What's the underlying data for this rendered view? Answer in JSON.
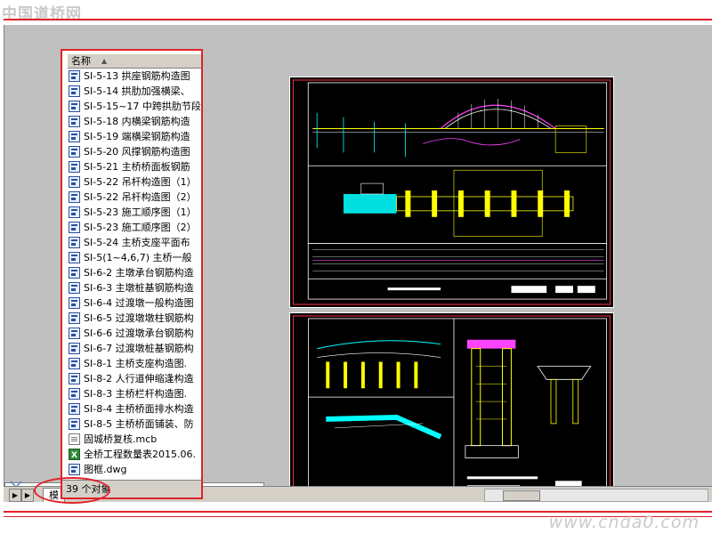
{
  "header": {
    "site_logo": "中国道桥网"
  },
  "file_panel": {
    "column_header": "名称",
    "items": [
      {
        "name": "SI-5-13 拱座钢筋构造图",
        "icon": "cad-drawing-icon"
      },
      {
        "name": "SI-5-14 拱肋加强横梁、",
        "icon": "cad-drawing-icon"
      },
      {
        "name": "SI-5-15~17 中跨拱肋节段",
        "icon": "cad-drawing-icon"
      },
      {
        "name": "SI-5-18 内横梁钢筋构造",
        "icon": "cad-drawing-icon"
      },
      {
        "name": "SI-5-19 端横梁钢筋构造",
        "icon": "cad-drawing-icon"
      },
      {
        "name": "SI-5-20 风撑钢筋构造图",
        "icon": "cad-drawing-icon"
      },
      {
        "name": "SI-5-21 主桥桥面板钢筋",
        "icon": "cad-drawing-icon"
      },
      {
        "name": "SI-5-22 吊杆构造图（1）",
        "icon": "cad-drawing-icon"
      },
      {
        "name": "SI-5-22 吊杆构造图（2）",
        "icon": "cad-drawing-icon"
      },
      {
        "name": "SI-5-23 施工顺序图（1）",
        "icon": "cad-drawing-icon"
      },
      {
        "name": "SI-5-23 施工顺序图（2）",
        "icon": "cad-drawing-icon"
      },
      {
        "name": "SI-5-24 主桥支座平面布",
        "icon": "cad-drawing-icon"
      },
      {
        "name": "SI-5(1~4,6,7) 主桥一般",
        "icon": "cad-drawing-icon"
      },
      {
        "name": "SI-6-2 主墩承台钢筋构造",
        "icon": "cad-drawing-icon"
      },
      {
        "name": "SI-6-3 主墩桩基钢筋构造",
        "icon": "cad-drawing-icon"
      },
      {
        "name": "SI-6-4 过渡墩一般构造图",
        "icon": "cad-drawing-icon"
      },
      {
        "name": "SI-6-5 过渡墩墩柱钢筋构",
        "icon": "cad-drawing-icon"
      },
      {
        "name": "SI-6-6 过渡墩承台钢筋构",
        "icon": "cad-drawing-icon"
      },
      {
        "name": "SI-6-7 过渡墩桩基钢筋构",
        "icon": "cad-drawing-icon"
      },
      {
        "name": "SI-8-1 主桥支座构造图.",
        "icon": "cad-drawing-icon"
      },
      {
        "name": "SI-8-2 人行道伸缩逢构造",
        "icon": "cad-drawing-icon"
      },
      {
        "name": "SI-8-3 主桥栏杆构造图.",
        "icon": "cad-drawing-icon"
      },
      {
        "name": "SI-8-4 主桥桥面排水构造",
        "icon": "cad-drawing-icon"
      },
      {
        "name": "SI-8-5 主桥桥面铺装、防",
        "icon": "cad-drawing-icon"
      },
      {
        "name": "固城桥复核.mcb",
        "icon": "generic-file-icon"
      },
      {
        "name": "全桥工程数量表2015.06.",
        "icon": "excel-file-icon"
      },
      {
        "name": "图框.dwg",
        "icon": "cad-drawing-icon"
      }
    ],
    "status": "39 个对象"
  },
  "statusbar": {
    "model_tab": "模"
  },
  "footer": {
    "watermark": "www.cnda0.com"
  },
  "colors": {
    "highlight_red": "#e0222a",
    "cad_background": "#000000",
    "workspace_gray": "#c0c0c0"
  }
}
